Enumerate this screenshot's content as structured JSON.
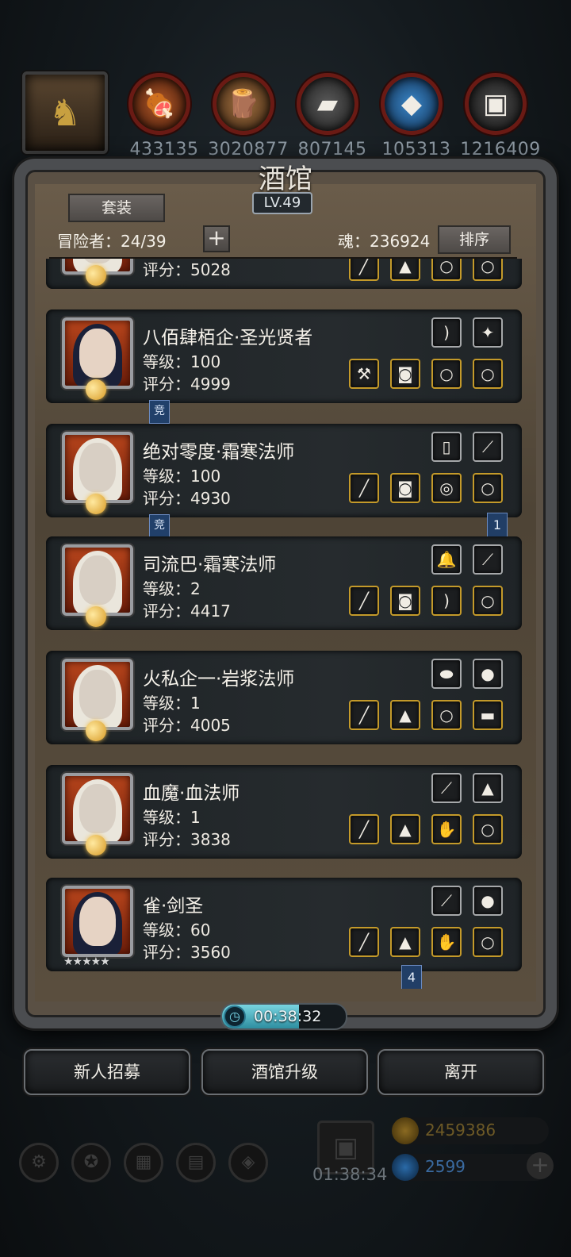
{
  "resources": [
    {
      "icon": "hero-portrait-icon",
      "value": ""
    },
    {
      "icon": "meat-icon",
      "value": "433135"
    },
    {
      "icon": "wood-icon",
      "value": "3020877"
    },
    {
      "icon": "iron-icon",
      "value": "807145"
    },
    {
      "icon": "crystal-icon",
      "value": "105313"
    },
    {
      "icon": "stone-icon",
      "value": "1216409"
    }
  ],
  "panel": {
    "title": "酒馆",
    "level": "LV.49",
    "set_button": "套装",
    "adventurers": "冒险者：24/39",
    "plus": "+",
    "soul": "魂：236924",
    "sort_button": "排序"
  },
  "heroes": [
    {
      "name": "",
      "level": "",
      "score": "评分：5028",
      "portrait": "red",
      "partial": true
    },
    {
      "name": "八佰肆栢企·圣光贤者",
      "level": "等级：100",
      "score": "评分：4999",
      "portrait": "dark-female",
      "tag": "竞"
    },
    {
      "name": "绝对零度·霜寒法师",
      "level": "等级：100",
      "score": "评分：4930",
      "portrait": "elf",
      "tag": "竞",
      "num_tag": "1"
    },
    {
      "name": "司流巴·霜寒法师",
      "level": "等级：2",
      "score": "评分：4417",
      "portrait": "elf"
    },
    {
      "name": "火私企一·岩浆法师",
      "level": "等级：1",
      "score": "评分：4005",
      "portrait": "elf"
    },
    {
      "name": "血魔·血法师",
      "level": "等级：1",
      "score": "评分：3838",
      "portrait": "elf"
    },
    {
      "name": "雀·剑圣",
      "level": "等级：60",
      "score": "评分：3560",
      "portrait": "dark",
      "stars": "★★★★★",
      "num_tag": "4"
    }
  ],
  "timer": {
    "time": "00:38:32",
    "progress": 0.62
  },
  "buttons": {
    "recruit": "新人招募",
    "upgrade": "酒馆升级",
    "leave": "离开"
  },
  "footer": {
    "gift_time": "01:38:34",
    "gold": "2459386",
    "gems": "2599",
    "plus": "+"
  },
  "colors": {
    "slot_gold": "#c49a2a",
    "panel_bg": "#5a5044",
    "card_bg": "#22272a"
  }
}
